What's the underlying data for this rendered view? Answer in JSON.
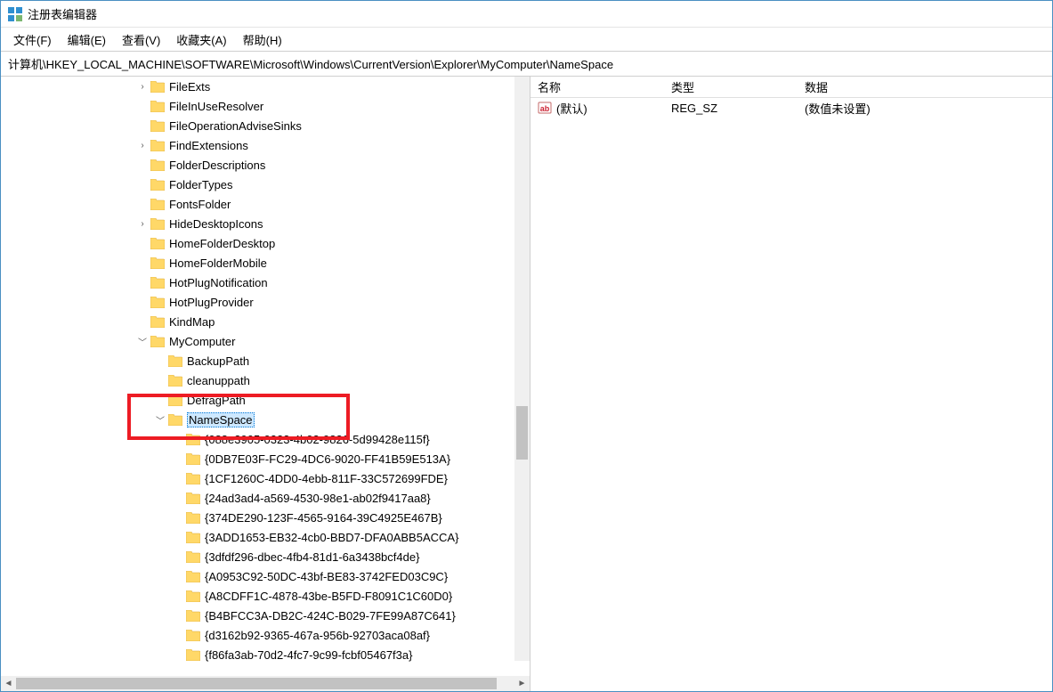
{
  "window": {
    "title": "注册表编辑器"
  },
  "menu": {
    "file": "文件(F)",
    "edit": "编辑(E)",
    "view": "查看(V)",
    "favorites": "收藏夹(A)",
    "help": "帮助(H)"
  },
  "address": "计算机\\HKEY_LOCAL_MACHINE\\SOFTWARE\\Microsoft\\Windows\\CurrentVersion\\Explorer\\MyComputer\\NameSpace",
  "tree": [
    {
      "indent": 8,
      "expander": "closed",
      "label": "FileExts"
    },
    {
      "indent": 8,
      "expander": "none",
      "label": "FileInUseResolver"
    },
    {
      "indent": 8,
      "expander": "none",
      "label": "FileOperationAdviseSinks"
    },
    {
      "indent": 8,
      "expander": "closed",
      "label": "FindExtensions"
    },
    {
      "indent": 8,
      "expander": "none",
      "label": "FolderDescriptions"
    },
    {
      "indent": 8,
      "expander": "none",
      "label": "FolderTypes"
    },
    {
      "indent": 8,
      "expander": "none",
      "label": "FontsFolder"
    },
    {
      "indent": 8,
      "expander": "closed",
      "label": "HideDesktopIcons"
    },
    {
      "indent": 8,
      "expander": "none",
      "label": "HomeFolderDesktop"
    },
    {
      "indent": 8,
      "expander": "none",
      "label": "HomeFolderMobile"
    },
    {
      "indent": 8,
      "expander": "none",
      "label": "HotPlugNotification"
    },
    {
      "indent": 8,
      "expander": "none",
      "label": "HotPlugProvider"
    },
    {
      "indent": 8,
      "expander": "none",
      "label": "KindMap"
    },
    {
      "indent": 8,
      "expander": "open",
      "label": "MyComputer"
    },
    {
      "indent": 9,
      "expander": "none",
      "label": "BackupPath"
    },
    {
      "indent": 9,
      "expander": "none",
      "label": "cleanuppath"
    },
    {
      "indent": 9,
      "expander": "none",
      "label": "DefragPath"
    },
    {
      "indent": 9,
      "expander": "open",
      "label": "NameSpace",
      "selected": true
    },
    {
      "indent": 10,
      "expander": "none",
      "label": "{088e3905-0323-4b02-9826-5d99428e115f}"
    },
    {
      "indent": 10,
      "expander": "none",
      "label": "{0DB7E03F-FC29-4DC6-9020-FF41B59E513A}"
    },
    {
      "indent": 10,
      "expander": "none",
      "label": "{1CF1260C-4DD0-4ebb-811F-33C572699FDE}"
    },
    {
      "indent": 10,
      "expander": "none",
      "label": "{24ad3ad4-a569-4530-98e1-ab02f9417aa8}"
    },
    {
      "indent": 10,
      "expander": "none",
      "label": "{374DE290-123F-4565-9164-39C4925E467B}"
    },
    {
      "indent": 10,
      "expander": "none",
      "label": "{3ADD1653-EB32-4cb0-BBD7-DFA0ABB5ACCA}"
    },
    {
      "indent": 10,
      "expander": "none",
      "label": "{3dfdf296-dbec-4fb4-81d1-6a3438bcf4de}"
    },
    {
      "indent": 10,
      "expander": "none",
      "label": "{A0953C92-50DC-43bf-BE83-3742FED03C9C}"
    },
    {
      "indent": 10,
      "expander": "none",
      "label": "{A8CDFF1C-4878-43be-B5FD-F8091C1C60D0}"
    },
    {
      "indent": 10,
      "expander": "none",
      "label": "{B4BFCC3A-DB2C-424C-B029-7FE99A87C641}"
    },
    {
      "indent": 10,
      "expander": "none",
      "label": "{d3162b92-9365-467a-956b-92703aca08af}"
    },
    {
      "indent": 10,
      "expander": "none",
      "label": "{f86fa3ab-70d2-4fc7-9c99-fcbf05467f3a}"
    }
  ],
  "list": {
    "columns": {
      "name": "名称",
      "type": "类型",
      "data": "数据"
    },
    "rows": [
      {
        "name": "(默认)",
        "type": "REG_SZ",
        "data": "(数值未设置)"
      }
    ]
  }
}
